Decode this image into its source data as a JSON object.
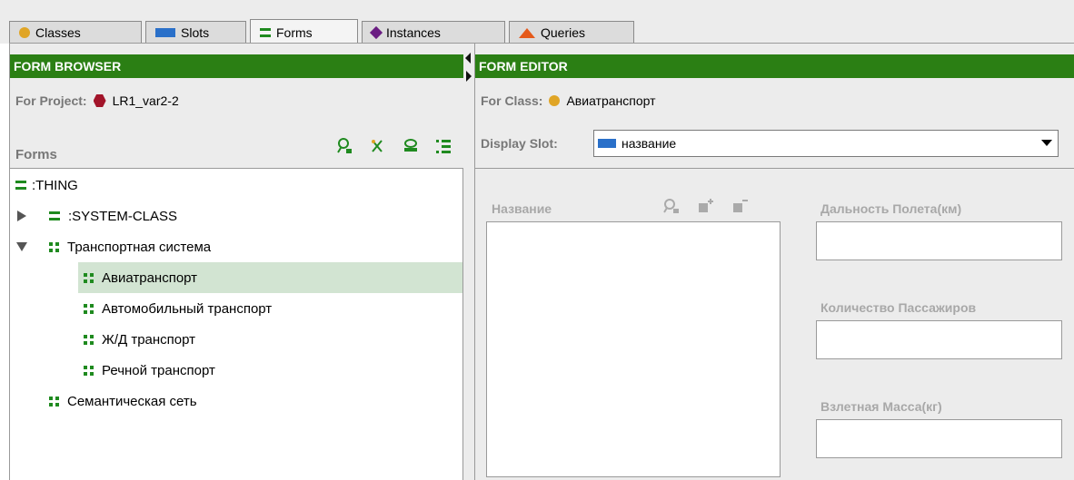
{
  "tabs": [
    {
      "label": "Classes",
      "icon": "class-circle-icon",
      "active": false
    },
    {
      "label": "Slots",
      "icon": "slot-rect-icon",
      "active": false
    },
    {
      "label": "Forms",
      "icon": "form-icon",
      "active": true
    },
    {
      "label": "Instances",
      "icon": "instance-diamond-icon",
      "active": false
    },
    {
      "label": "Queries",
      "icon": "query-triangle-icon",
      "active": false
    }
  ],
  "form_browser": {
    "title": "FORM BROWSER",
    "project_label": "For Project:",
    "project_name": "LR1_var2-2",
    "forms_label": "Forms",
    "toolbar": [
      "find-icon",
      "remove-customizations-icon",
      "relayout-icon",
      "layout-like-icon"
    ],
    "tree": [
      {
        "label": ":THING",
        "level": 0,
        "expander": "none",
        "icon": "form-icon",
        "selected": false
      },
      {
        "label": ":SYSTEM-CLASS",
        "level": 1,
        "expander": "collapsed",
        "icon": "form-icon",
        "selected": false
      },
      {
        "label": "Транспортная система",
        "level": 1,
        "expander": "expanded",
        "icon": "grid-form-icon",
        "selected": false
      },
      {
        "label": "Авиатранспорт",
        "level": 2,
        "expander": "none",
        "icon": "grid-form-icon",
        "selected": true
      },
      {
        "label": "Автомобильный транспорт",
        "level": 2,
        "expander": "none",
        "icon": "grid-form-icon",
        "selected": false
      },
      {
        "label": "Ж/Д транспорт",
        "level": 2,
        "expander": "none",
        "icon": "grid-form-icon",
        "selected": false
      },
      {
        "label": "Речной транспорт",
        "level": 2,
        "expander": "none",
        "icon": "grid-form-icon",
        "selected": false
      },
      {
        "label": "Семантическая сеть",
        "level": 1,
        "expander": "none",
        "icon": "grid-form-icon",
        "selected": false
      }
    ]
  },
  "form_editor": {
    "title": "FORM EDITOR",
    "class_label": "For Class:",
    "class_name": "Авиатранспорт",
    "display_slot_label": "Display Slot:",
    "display_slot_value": "название",
    "fields": {
      "name_label": "Название",
      "distance_label": "Дальность Полета(км)",
      "passengers_label": "Количество Пассажиров",
      "mass_label": "Взлетная Масса(кг)"
    }
  },
  "colors": {
    "header_green": "#2b7f14",
    "selection": "#d2e4d2",
    "form_icon_green": "#1f8a1f"
  }
}
